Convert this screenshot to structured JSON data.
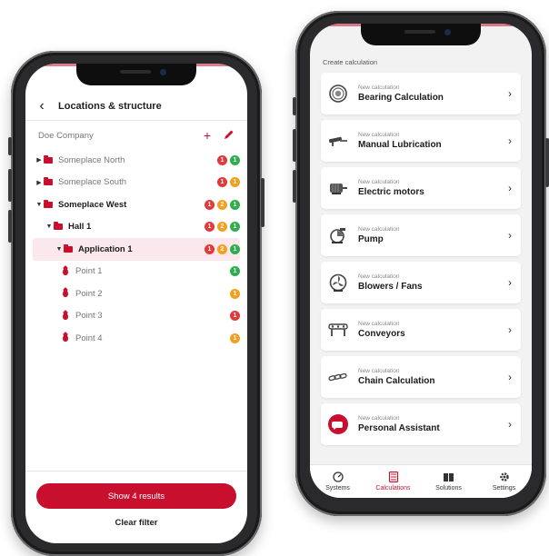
{
  "colors": {
    "accent": "#c8102e",
    "red": "#e03a3a",
    "orange": "#f2a020",
    "green": "#2fae4e"
  },
  "left": {
    "header": {
      "back_icon": "chevron-left-icon",
      "title": "Locations & structure"
    },
    "company": {
      "name": "Doe Company",
      "add_icon": "plus-icon",
      "edit_icon": "pencil-icon"
    },
    "tree": [
      {
        "label": "Someplace North",
        "level": 0,
        "type": "folder",
        "expanded": false,
        "badges": [
          {
            "v": "1",
            "c": "red"
          },
          {
            "v": "1",
            "c": "green"
          }
        ]
      },
      {
        "label": "Someplace South",
        "level": 0,
        "type": "folder",
        "expanded": false,
        "badges": [
          {
            "v": "1",
            "c": "red"
          },
          {
            "v": "1",
            "c": "orange"
          }
        ]
      },
      {
        "label": "Someplace West",
        "level": 0,
        "type": "folder",
        "expanded": true,
        "badges": [
          {
            "v": "1",
            "c": "red"
          },
          {
            "v": "2",
            "c": "orange"
          },
          {
            "v": "1",
            "c": "green"
          }
        ]
      },
      {
        "label": "Hall 1",
        "level": 1,
        "type": "folder",
        "expanded": true,
        "badges": [
          {
            "v": "1",
            "c": "red"
          },
          {
            "v": "2",
            "c": "orange"
          },
          {
            "v": "1",
            "c": "green"
          }
        ]
      },
      {
        "label": "Application 1",
        "level": 2,
        "type": "folder",
        "expanded": true,
        "selected": true,
        "badges": [
          {
            "v": "1",
            "c": "red"
          },
          {
            "v": "2",
            "c": "orange"
          },
          {
            "v": "1",
            "c": "green"
          }
        ]
      },
      {
        "label": "Point 1",
        "level": 3,
        "type": "point",
        "badges": [
          {
            "v": "1",
            "c": "green"
          }
        ]
      },
      {
        "label": "Point 2",
        "level": 3,
        "type": "point",
        "badges": [
          {
            "v": "1",
            "c": "orange"
          }
        ]
      },
      {
        "label": "Point 3",
        "level": 3,
        "type": "point",
        "badges": [
          {
            "v": "1",
            "c": "red"
          }
        ]
      },
      {
        "label": "Point 4",
        "level": 3,
        "type": "point",
        "badges": [
          {
            "v": "1",
            "c": "orange"
          }
        ]
      }
    ],
    "show_button": "Show 4 results",
    "clear_filter": "Clear filter"
  },
  "right": {
    "section_title": "Create calculation",
    "cards": [
      {
        "sub": "New calculation",
        "name": "Bearing Calculation",
        "icon": "bearing-icon"
      },
      {
        "sub": "New calculation",
        "name": "Manual Lubrication",
        "icon": "grease-gun-icon"
      },
      {
        "sub": "New calculation",
        "name": "Electric motors",
        "icon": "motor-icon"
      },
      {
        "sub": "New calculation",
        "name": "Pump",
        "icon": "pump-icon"
      },
      {
        "sub": "New calculation",
        "name": "Blowers / Fans",
        "icon": "fan-icon"
      },
      {
        "sub": "New calculation",
        "name": "Conveyors",
        "icon": "conveyor-icon"
      },
      {
        "sub": "New calculation",
        "name": "Chain Calculation",
        "icon": "chain-icon"
      },
      {
        "sub": "New calculation",
        "name": "Personal Assistant",
        "icon": "chat-icon"
      }
    ],
    "tabs": [
      {
        "label": "Systems",
        "icon": "gauge-icon",
        "active": false
      },
      {
        "label": "Calculations",
        "icon": "calculator-icon",
        "active": true
      },
      {
        "label": "Solutions",
        "icon": "book-icon",
        "active": false
      },
      {
        "label": "Settings",
        "icon": "gear-icon",
        "active": false
      }
    ]
  }
}
